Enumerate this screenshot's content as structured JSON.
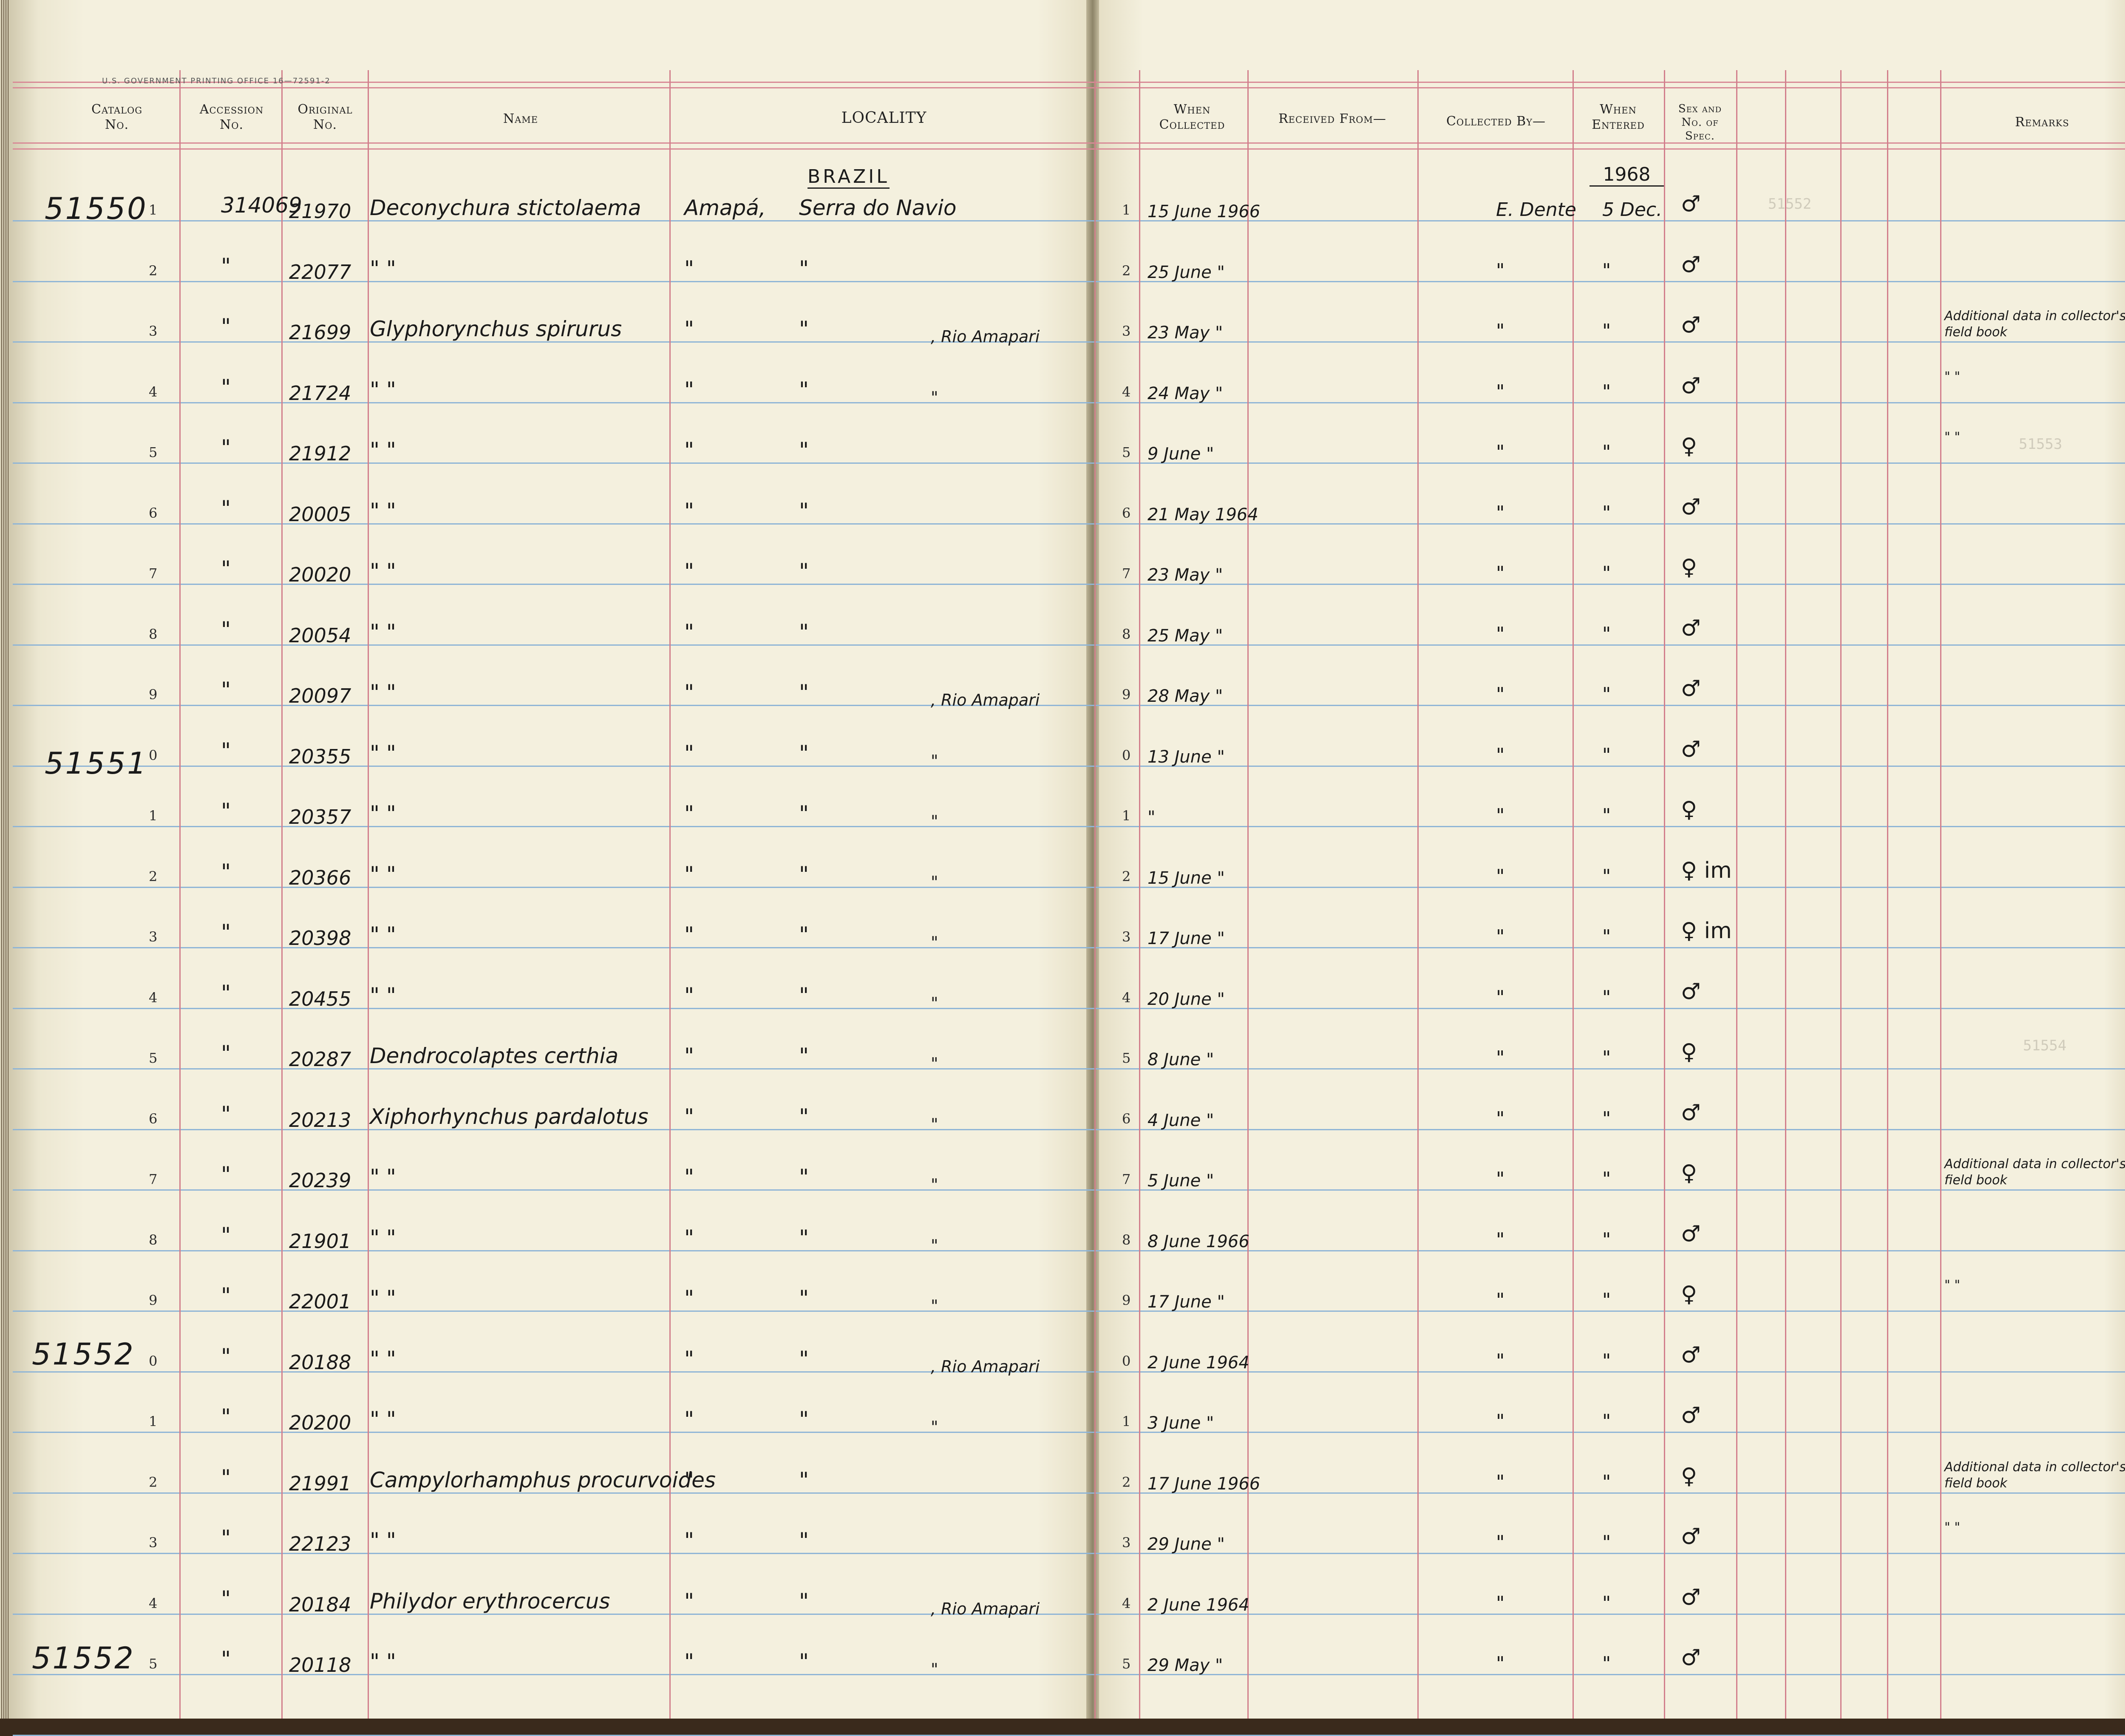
{
  "printer_line": "U.S. GOVERNMENT PRINTING OFFICE  16—72591-2",
  "headers": {
    "catalog": [
      "Catalog",
      "No."
    ],
    "accession": [
      "Accession",
      "No."
    ],
    "original": [
      "Original",
      "No."
    ],
    "name": "Name",
    "locality": "LOCALITY",
    "when_collected": [
      "When",
      "Collected"
    ],
    "received_from": "Received From—",
    "collected_by": "Collected By—",
    "when_entered": [
      "When",
      "Entered"
    ],
    "sex": [
      "Sex and",
      "No. of",
      "Spec."
    ],
    "remarks": "Remarks"
  },
  "section": {
    "country": "BRAZIL",
    "year_entered": "1968"
  },
  "catalog_marks": [
    "51550",
    "51551",
    "51552",
    "51552"
  ],
  "rows": [
    {
      "n": "1",
      "accession": "314069",
      "original": "21970",
      "name": "Deconychura stictolaema",
      "locality": "Amapá,",
      "locality2": "Serra do Navio",
      "locality3": "",
      "serial_r": "1",
      "when": "15 June 1966",
      "by": "E. Dente",
      "entered": "5 Dec.",
      "sex": "♂",
      "remark": ""
    },
    {
      "n": "2",
      "accession": "\"",
      "original": "22077",
      "name": "\"          \"",
      "locality": "\"",
      "locality2": "\"",
      "locality3": "",
      "serial_r": "2",
      "when": "25 June \"",
      "by": "\"",
      "entered": "\"",
      "sex": "♂",
      "remark": ""
    },
    {
      "n": "3",
      "accession": "\"",
      "original": "21699",
      "name": "Glyphorynchus spirurus",
      "locality": "\"",
      "locality2": "\"",
      "locality3": ", Rio Amapari",
      "serial_r": "3",
      "when": "23 May \"",
      "by": "\"",
      "entered": "\"",
      "sex": "♂",
      "remark": "Additional data in collector's field book"
    },
    {
      "n": "4",
      "accession": "\"",
      "original": "21724",
      "name": "\"          \"",
      "locality": "\"",
      "locality2": "\"",
      "locality3": "\"",
      "serial_r": "4",
      "when": "24 May \"",
      "by": "\"",
      "entered": "\"",
      "sex": "♂",
      "remark": "\"     \""
    },
    {
      "n": "5",
      "accession": "\"",
      "original": "21912",
      "name": "\"          \"",
      "locality": "\"",
      "locality2": "\"",
      "locality3": "",
      "serial_r": "5",
      "when": "9 June \"",
      "by": "\"",
      "entered": "\"",
      "sex": "♀",
      "remark": "\"     \""
    },
    {
      "n": "6",
      "accession": "\"",
      "original": "20005",
      "name": "\"          \"",
      "locality": "\"",
      "locality2": "\"",
      "locality3": "",
      "serial_r": "6",
      "when": "21 May 1964",
      "by": "\"",
      "entered": "\"",
      "sex": "♂",
      "remark": ""
    },
    {
      "n": "7",
      "accession": "\"",
      "original": "20020",
      "name": "\"          \"",
      "locality": "\"",
      "locality2": "\"",
      "locality3": "",
      "serial_r": "7",
      "when": "23 May \"",
      "by": "\"",
      "entered": "\"",
      "sex": "♀",
      "remark": ""
    },
    {
      "n": "8",
      "accession": "\"",
      "original": "20054",
      "name": "\"          \"",
      "locality": "\"",
      "locality2": "\"",
      "locality3": "",
      "serial_r": "8",
      "when": "25 May \"",
      "by": "\"",
      "entered": "\"",
      "sex": "♂",
      "remark": ""
    },
    {
      "n": "9",
      "accession": "\"",
      "original": "20097",
      "name": "\"          \"",
      "locality": "\"",
      "locality2": "\"",
      "locality3": ", Rio Amapari",
      "serial_r": "9",
      "when": "28 May \"",
      "by": "\"",
      "entered": "\"",
      "sex": "♂",
      "remark": ""
    },
    {
      "n": "0",
      "accession": "\"",
      "original": "20355",
      "name": "\"          \"",
      "locality": "\"",
      "locality2": "\"",
      "locality3": "\"",
      "serial_r": "0",
      "when": "13 June \"",
      "by": "\"",
      "entered": "\"",
      "sex": "♂",
      "remark": ""
    },
    {
      "n": "1",
      "accession": "\"",
      "original": "20357",
      "name": "\"          \"",
      "locality": "\"",
      "locality2": "\"",
      "locality3": "\"",
      "serial_r": "1",
      "when": "\"",
      "by": "\"",
      "entered": "\"",
      "sex": "♀",
      "remark": ""
    },
    {
      "n": "2",
      "accession": "\"",
      "original": "20366",
      "name": "\"          \"",
      "locality": "\"",
      "locality2": "\"",
      "locality3": "\"",
      "serial_r": "2",
      "when": "15 June \"",
      "by": "\"",
      "entered": "\"",
      "sex": "♀ im",
      "remark": ""
    },
    {
      "n": "3",
      "accession": "\"",
      "original": "20398",
      "name": "\"          \"",
      "locality": "\"",
      "locality2": "\"",
      "locality3": "\"",
      "serial_r": "3",
      "when": "17 June \"",
      "by": "\"",
      "entered": "\"",
      "sex": "♀ im",
      "remark": ""
    },
    {
      "n": "4",
      "accession": "\"",
      "original": "20455",
      "name": "\"          \"",
      "locality": "\"",
      "locality2": "\"",
      "locality3": "\"",
      "serial_r": "4",
      "when": "20 June \"",
      "by": "\"",
      "entered": "\"",
      "sex": "♂",
      "remark": ""
    },
    {
      "n": "5",
      "accession": "\"",
      "original": "20287",
      "name": "Dendrocolaptes certhia",
      "locality": "\"",
      "locality2": "\"",
      "locality3": "\"",
      "serial_r": "5",
      "when": "8 June \"",
      "by": "\"",
      "entered": "\"",
      "sex": "♀",
      "remark": ""
    },
    {
      "n": "6",
      "accession": "\"",
      "original": "20213",
      "name": "Xiphorhynchus pardalotus",
      "locality": "\"",
      "locality2": "\"",
      "locality3": "\"",
      "serial_r": "6",
      "when": "4 June \"",
      "by": "\"",
      "entered": "\"",
      "sex": "♂",
      "remark": ""
    },
    {
      "n": "7",
      "accession": "\"",
      "original": "20239",
      "name": "\"          \"",
      "locality": "\"",
      "locality2": "\"",
      "locality3": "\"",
      "serial_r": "7",
      "when": "5 June \"",
      "by": "\"",
      "entered": "\"",
      "sex": "♀",
      "remark": "Additional data in collector's field book"
    },
    {
      "n": "8",
      "accession": "\"",
      "original": "21901",
      "name": "\"          \"",
      "locality": "\"",
      "locality2": "\"",
      "locality3": "\"",
      "serial_r": "8",
      "when": "8 June 1966",
      "by": "\"",
      "entered": "\"",
      "sex": "♂",
      "remark": ""
    },
    {
      "n": "9",
      "accession": "\"",
      "original": "22001",
      "name": "\"          \"",
      "locality": "\"",
      "locality2": "\"",
      "locality3": "\"",
      "serial_r": "9",
      "when": "17 June \"",
      "by": "\"",
      "entered": "\"",
      "sex": "♀",
      "remark": "\"     \""
    },
    {
      "n": "0",
      "accession": "\"",
      "original": "20188",
      "name": "\"          \"",
      "locality": "\"",
      "locality2": "\"",
      "locality3": ", Rio Amapari",
      "serial_r": "0",
      "when": "2 June 1964",
      "by": "\"",
      "entered": "\"",
      "sex": "♂",
      "remark": ""
    },
    {
      "n": "1",
      "accession": "\"",
      "original": "20200",
      "name": "\"          \"",
      "locality": "\"",
      "locality2": "\"",
      "locality3": "\"",
      "serial_r": "1",
      "when": "3 June \"",
      "by": "\"",
      "entered": "\"",
      "sex": "♂",
      "remark": ""
    },
    {
      "n": "2",
      "accession": "\"",
      "original": "21991",
      "name": "Campylorhamphus procurvoides",
      "locality": "\"",
      "locality2": "\"",
      "locality3": "",
      "serial_r": "2",
      "when": "17 June 1966",
      "by": "\"",
      "entered": "\"",
      "sex": "♀",
      "remark": "Additional data in collector's field book"
    },
    {
      "n": "3",
      "accession": "\"",
      "original": "22123",
      "name": "\"          \"",
      "locality": "\"",
      "locality2": "\"",
      "locality3": "",
      "serial_r": "3",
      "when": "29 June \"",
      "by": "\"",
      "entered": "\"",
      "sex": "♂",
      "remark": "\"     \""
    },
    {
      "n": "4",
      "accession": "\"",
      "original": "20184",
      "name": "Philydor erythrocercus",
      "locality": "\"",
      "locality2": "\"",
      "locality3": ", Rio Amapari",
      "serial_r": "4",
      "when": "2 June 1964",
      "by": "\"",
      "entered": "\"",
      "sex": "♂",
      "remark": ""
    },
    {
      "n": "5",
      "accession": "\"",
      "original": "20118",
      "name": "\"          \"",
      "locality": "\"",
      "locality2": "\"",
      "locality3": "\"",
      "serial_r": "5",
      "when": "29 May \"",
      "by": "\"",
      "entered": "\"",
      "sex": "♂",
      "remark": ""
    }
  ]
}
